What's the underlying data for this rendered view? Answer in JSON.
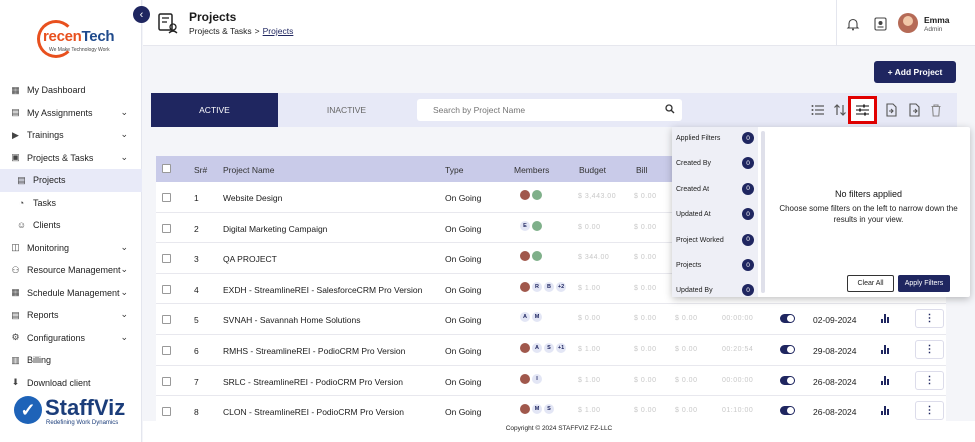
{
  "company_logo": {
    "name_prefix": "recen",
    "name_suffix": "Tech",
    "tagline": "We Make Technology Work"
  },
  "sidebar": {
    "items": [
      {
        "label": "My Dashboard",
        "icon": "dashboard-icon",
        "chevron": false
      },
      {
        "label": "My Assignments",
        "icon": "assignments-icon",
        "chevron": true
      },
      {
        "label": "Trainings",
        "icon": "training-icon",
        "chevron": true
      },
      {
        "label": "Projects & Tasks",
        "icon": "projects-tasks-icon",
        "chevron": true
      },
      {
        "label": "Projects",
        "icon": "projects-icon",
        "chevron": false,
        "sub": true,
        "active": true
      },
      {
        "label": "Tasks",
        "icon": "tasks-icon",
        "chevron": false,
        "sub": true
      },
      {
        "label": "Clients",
        "icon": "clients-icon",
        "chevron": false,
        "sub": true
      },
      {
        "label": "Monitoring",
        "icon": "monitoring-icon",
        "chevron": true
      },
      {
        "label": "Resource Management",
        "icon": "resource-icon",
        "chevron": true
      },
      {
        "label": "Schedule Management",
        "icon": "schedule-icon",
        "chevron": true
      },
      {
        "label": "Reports",
        "icon": "reports-icon",
        "chevron": true
      },
      {
        "label": "Configurations",
        "icon": "configurations-icon",
        "chevron": true
      },
      {
        "label": "Billing",
        "icon": "billing-icon",
        "chevron": false
      },
      {
        "label": "Download client",
        "icon": "download-icon",
        "chevron": false
      }
    ]
  },
  "brand": {
    "name": "StaffViz",
    "tagline": "Redefining Work Dynamics"
  },
  "header": {
    "title": "Projects",
    "breadcrumb": [
      "Projects & Tasks",
      "Projects"
    ],
    "breadcrumb_sep": ">",
    "user": {
      "name": "Emma",
      "role": "Admin"
    }
  },
  "toolbar": {
    "add_label": "+ Add Project",
    "tabs": [
      "ACTIVE",
      "INACTIVE"
    ],
    "search_placeholder": "Search by Project Name"
  },
  "table": {
    "columns": [
      "Sr#",
      "Project Name",
      "Type",
      "Members",
      "Budget",
      "Bill"
    ],
    "rows": [
      {
        "sr": "1",
        "name": "Website Design",
        "type": "On Going",
        "members": [
          "img",
          "img"
        ],
        "budget": "$ 3,443.00",
        "bill": "$ 0.00",
        "spent": "",
        "time": "",
        "date": ""
      },
      {
        "sr": "2",
        "name": "Digital Marketing Campaign",
        "type": "On Going",
        "members": [
          "E",
          "img"
        ],
        "budget": "$ 0.00",
        "bill": "$ 0.00",
        "spent": "",
        "time": "",
        "date": ""
      },
      {
        "sr": "3",
        "name": "QA PROJECT",
        "type": "On Going",
        "members": [
          "img",
          "img"
        ],
        "budget": "$ 344.00",
        "bill": "$ 0.00",
        "spent": "",
        "time": "",
        "date": ""
      },
      {
        "sr": "4",
        "name": "EXDH - StreamlineREI - SalesforceCRM Pro Version",
        "type": "On Going",
        "members": [
          "img",
          "R",
          "B",
          "+2"
        ],
        "budget": "$ 1.00",
        "bill": "$ 0.00",
        "spent": "",
        "time": "",
        "date": ""
      },
      {
        "sr": "5",
        "name": "SVNAH - Savannah Home Solutions",
        "type": "On Going",
        "members": [
          "A",
          "M"
        ],
        "budget": "$ 0.00",
        "bill": "$ 0.00",
        "spent": "$ 0.00",
        "time": "00:00:00",
        "date": "02-09-2024"
      },
      {
        "sr": "6",
        "name": "RMHS - StreamlineREI - PodioCRM Pro Version",
        "type": "On Going",
        "members": [
          "img",
          "A",
          "S",
          "+1"
        ],
        "budget": "$ 1.00",
        "bill": "$ 0.00",
        "spent": "$ 0.00",
        "time": "00:20:54",
        "date": "29-08-2024"
      },
      {
        "sr": "7",
        "name": "SRLC - StreamlineREI - PodioCRM Pro Version",
        "type": "On Going",
        "members": [
          "img",
          "I"
        ],
        "budget": "$ 1.00",
        "bill": "$ 0.00",
        "spent": "$ 0.00",
        "time": "00:00:00",
        "date": "26-08-2024"
      },
      {
        "sr": "8",
        "name": "CLON - StreamlineREI - PodioCRM Pro Version",
        "type": "On Going",
        "members": [
          "img",
          "M",
          "S"
        ],
        "budget": "$ 1.00",
        "bill": "$ 0.00",
        "spent": "$ 0.00",
        "time": "01:10:00",
        "date": "26-08-2024"
      }
    ]
  },
  "filter_panel": {
    "items": [
      {
        "label": "Applied Filters",
        "count": "0"
      },
      {
        "label": "Created By",
        "count": "0"
      },
      {
        "label": "Created At",
        "count": "0"
      },
      {
        "label": "Updated At",
        "count": "0"
      },
      {
        "label": "Project Worked",
        "count": "0"
      },
      {
        "label": "Projects",
        "count": "0"
      },
      {
        "label": "Updated By",
        "count": "0"
      }
    ],
    "empty_title": "No filters applied",
    "empty_desc": "Choose some filters on the left to narrow down the results in your view.",
    "clear_label": "Clear All",
    "apply_label": "Apply Filters"
  },
  "footer": {
    "copyright": "Copyright © 2024 STAFFVIZ FZ-LLC"
  },
  "colors": {
    "primary": "#1f2660",
    "highlight": "#e10000",
    "accent": "#e8501e"
  }
}
